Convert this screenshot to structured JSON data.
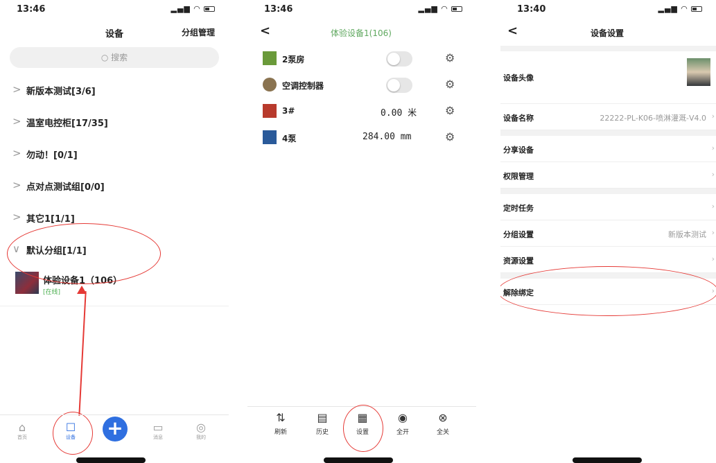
{
  "phone1": {
    "time": "13:46",
    "title": "设备",
    "group_mgmt": "分组管理",
    "search_placeholder": "搜索",
    "groups": [
      {
        "label": "新版本测试[3/6]"
      },
      {
        "label": "温室电控柜[17/35]"
      },
      {
        "label": "勿动！[0/1]"
      },
      {
        "label": "点对点测试组[0/0]"
      },
      {
        "label": "其它1[1/1]"
      },
      {
        "label": "默认分组[1/1]"
      }
    ],
    "device": {
      "name": "体验设备1（106）",
      "status": "[在线]"
    },
    "tabs": [
      {
        "label": "首页",
        "icon": "home-icon"
      },
      {
        "label": "设备",
        "icon": "router-icon"
      },
      {
        "label": "消息",
        "icon": "message-icon"
      },
      {
        "label": "我的",
        "icon": "user-icon"
      }
    ]
  },
  "phone2": {
    "time": "13:46",
    "title": "体验设备1(106)",
    "items": [
      {
        "name": "2泵房",
        "kind": "toggle",
        "value": ""
      },
      {
        "name": "空调控制器",
        "kind": "toggle",
        "value": ""
      },
      {
        "name": "3#",
        "kind": "value",
        "value": "0.00 米"
      },
      {
        "name": "4泵",
        "kind": "value",
        "value": "284.00 mm"
      }
    ],
    "tabs": [
      {
        "label": "刷新",
        "icon": "refresh-icon"
      },
      {
        "label": "历史",
        "icon": "history-icon"
      },
      {
        "label": "设置",
        "icon": "settings-icon"
      },
      {
        "label": "全开",
        "icon": "all-on-icon"
      },
      {
        "label": "全关",
        "icon": "all-off-icon"
      }
    ]
  },
  "phone3": {
    "time": "13:40",
    "title": "设备设置",
    "rows": {
      "avatar": "设备头像",
      "name": "设备名称",
      "name_value": "22222-PL-K06-喷淋灌溉-V4.0",
      "share": "分享设备",
      "perm": "权限管理",
      "timer": "定时任务",
      "group": "分组设置",
      "group_value": "新版本测试",
      "resource": "资源设置",
      "unbind": "解除绑定"
    }
  },
  "colors": {
    "accent": "#2f6fe0",
    "online": "#4caf50",
    "annotation": "#e53935",
    "title_green": "#5fa85f"
  }
}
